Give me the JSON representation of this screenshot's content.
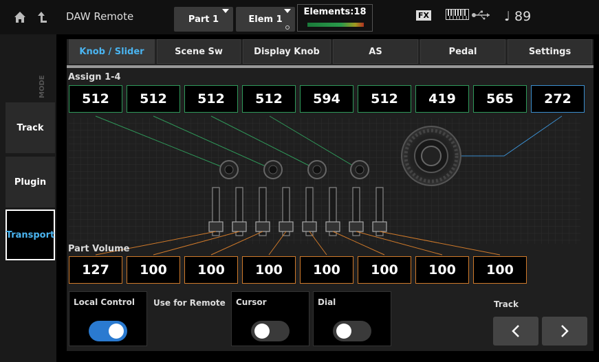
{
  "header": {
    "title": "DAW Remote",
    "part_label": "Part 1",
    "elem_label": "Elem 1",
    "elements_label": "Elements:18",
    "fx_label": "FX",
    "tempo": "♩ 89"
  },
  "mode": {
    "label": "MODE",
    "buttons": [
      "Track",
      "Plugin",
      "Transport"
    ],
    "active": "Transport"
  },
  "tabs": [
    {
      "label": "Knob / Slider",
      "active": true
    },
    {
      "label": "Scene Sw",
      "active": false
    },
    {
      "label": "Display Knob",
      "active": false
    },
    {
      "label": "AS",
      "active": false
    },
    {
      "label": "Pedal",
      "active": false
    },
    {
      "label": "Settings",
      "active": false
    }
  ],
  "assign": {
    "label": "Assign 1-4",
    "values": [
      "512",
      "512",
      "512",
      "512",
      "594",
      "512",
      "419",
      "565",
      "272"
    ]
  },
  "part_volume": {
    "label": "Part Volume",
    "values": [
      "127",
      "100",
      "100",
      "100",
      "100",
      "100",
      "100",
      "100"
    ]
  },
  "controls": {
    "local_control_label": "Local Control",
    "local_control_on": true,
    "use_for_remote_label": "Use for Remote",
    "cursor_label": "Cursor",
    "cursor_on": false,
    "dial_label": "Dial",
    "dial_on": false,
    "track_label": "Track"
  },
  "colors": {
    "accent": "#4ab4f0",
    "assign_border": "#2f9a5a",
    "dial_border": "#3b8fd0",
    "volume_border": "#d07a2a",
    "toggle_on": "#2a7ad0"
  }
}
